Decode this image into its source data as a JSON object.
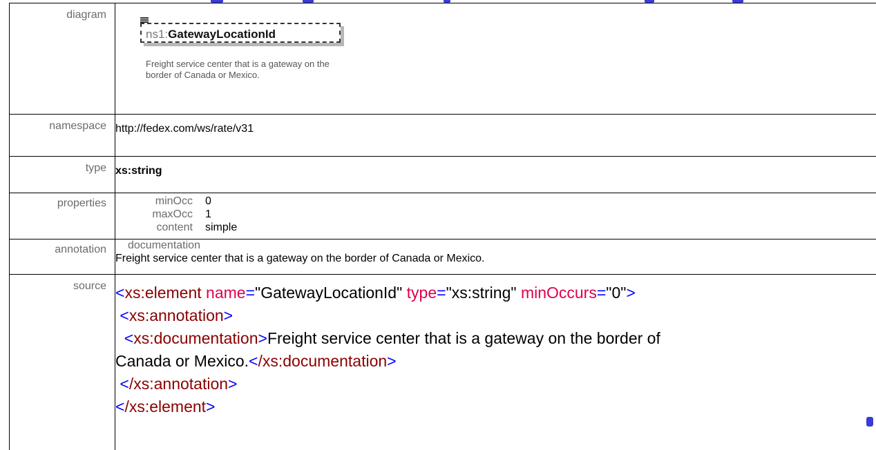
{
  "rows": {
    "diagram": {
      "label": "diagram",
      "element_prefix": "ns1:",
      "element_name": "GatewayLocationId",
      "description": "Freight service center that is a gateway on the border of Canada or Mexico."
    },
    "namespace": {
      "label": "namespace",
      "value": "http://fedex.com/ws/rate/v31"
    },
    "type": {
      "label": "type",
      "value": "xs:string"
    },
    "properties": {
      "label": "properties",
      "items": [
        {
          "key": "minOcc",
          "value": "0"
        },
        {
          "key": "maxOcc",
          "value": "1"
        },
        {
          "key": "content",
          "value": "simple"
        }
      ]
    },
    "annotation": {
      "label": "annotation",
      "head": "documentation",
      "text": "Freight service center that is a gateway on the border of Canada or Mexico."
    },
    "source": {
      "label": "source",
      "element_open_tag": "xs:element",
      "attr_name_key": "name",
      "attr_name_value": "\"GatewayLocationId\"",
      "attr_type_key": "type",
      "attr_type_value": "\"xs:string\"",
      "attr_min_key": "minOccurs",
      "attr_min_value": "\"0\"",
      "annotation_tag": "xs:annotation",
      "documentation_tag": "xs:documentation",
      "doc_text_1": "Freight service center that is a gateway on the border of",
      "doc_text_2": "Canada or Mexico.",
      "doc_close_tag": "/xs:documentation",
      "annotation_close_tag": "/xs:annotation",
      "element_close_tag": "/xs:element"
    }
  },
  "colors": {
    "bracket": "#0000ff",
    "tag": "#8b0000",
    "attr": "#e0004e",
    "label": "#6b6b6b"
  }
}
